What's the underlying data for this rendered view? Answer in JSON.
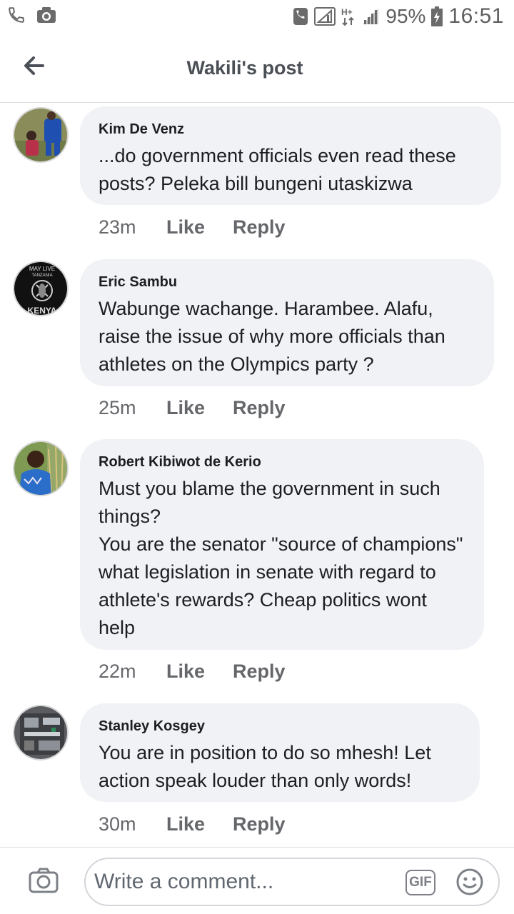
{
  "status_bar": {
    "battery_percent": "95%",
    "time": "16:51",
    "icons": [
      "phone-icon",
      "camera-notification-icon",
      "call-signal-icon",
      "signal-icon",
      "h-plus-icon",
      "signal-bars-icon",
      "battery-icon"
    ]
  },
  "header": {
    "title": "Wakili's post",
    "back_icon": "arrow-left-icon"
  },
  "comments": [
    {
      "author": "Kim De Venz",
      "text": "...do government officials even read these posts? Peleka bill bungeni utaskizwa",
      "time": "23m",
      "like": "Like",
      "reply": "Reply"
    },
    {
      "author": "Eric Sambu",
      "text": "Wabunge wachange. Harambee. Alafu, raise the issue of why more officials than athletes on the Olympics party ?",
      "time": "25m",
      "like": "Like",
      "reply": "Reply",
      "avatar_text_top": "MAY LIVE",
      "avatar_text_mid": "TANZANIA",
      "avatar_text_bottom": "KENYA"
    },
    {
      "author": "Robert Kibiwot de Kerio",
      "text": "Must you blame the government in such things?\nYou are the senator \"source of champions\" what legislation in senate with regard to athlete's rewards? Cheap politics wont help",
      "time": "22m",
      "like": "Like",
      "reply": "Reply"
    },
    {
      "author": "Stanley Kosgey",
      "text": "You are in position to do so mhesh!  Let action speak louder than only words!",
      "time": "30m",
      "like": "Like",
      "reply": "Reply"
    }
  ],
  "composer": {
    "placeholder": "Write a comment...",
    "gif_label": "GIF",
    "camera_icon": "camera-icon",
    "emoji_icon": "smiley-icon"
  },
  "colors": {
    "bubble": "#f0f2f5",
    "meta_text": "#65676b",
    "title_text": "#4b4f56"
  }
}
